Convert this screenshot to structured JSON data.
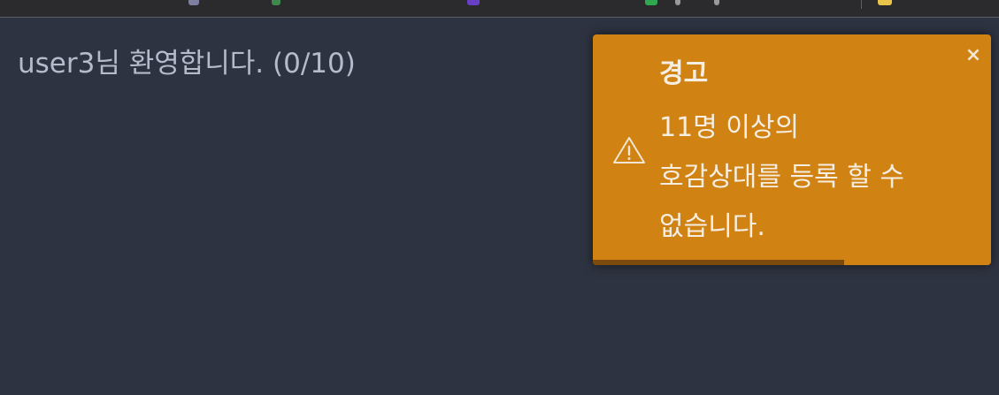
{
  "welcome": {
    "text": "user3님 환영합니다. (0/10)"
  },
  "toast": {
    "type": "warning",
    "icon": "warning-icon",
    "close_icon": "close-icon",
    "close_label": "×",
    "title": "경고",
    "message_lines": [
      "11명 이상의",
      "호감상대를 등록 할 수",
      "없습니다."
    ],
    "progress": 0.63,
    "colors": {
      "background": "#d08212",
      "progress": "#7b4a0c",
      "text": "#f6eee2"
    }
  },
  "page": {
    "background": "#2d3340"
  }
}
